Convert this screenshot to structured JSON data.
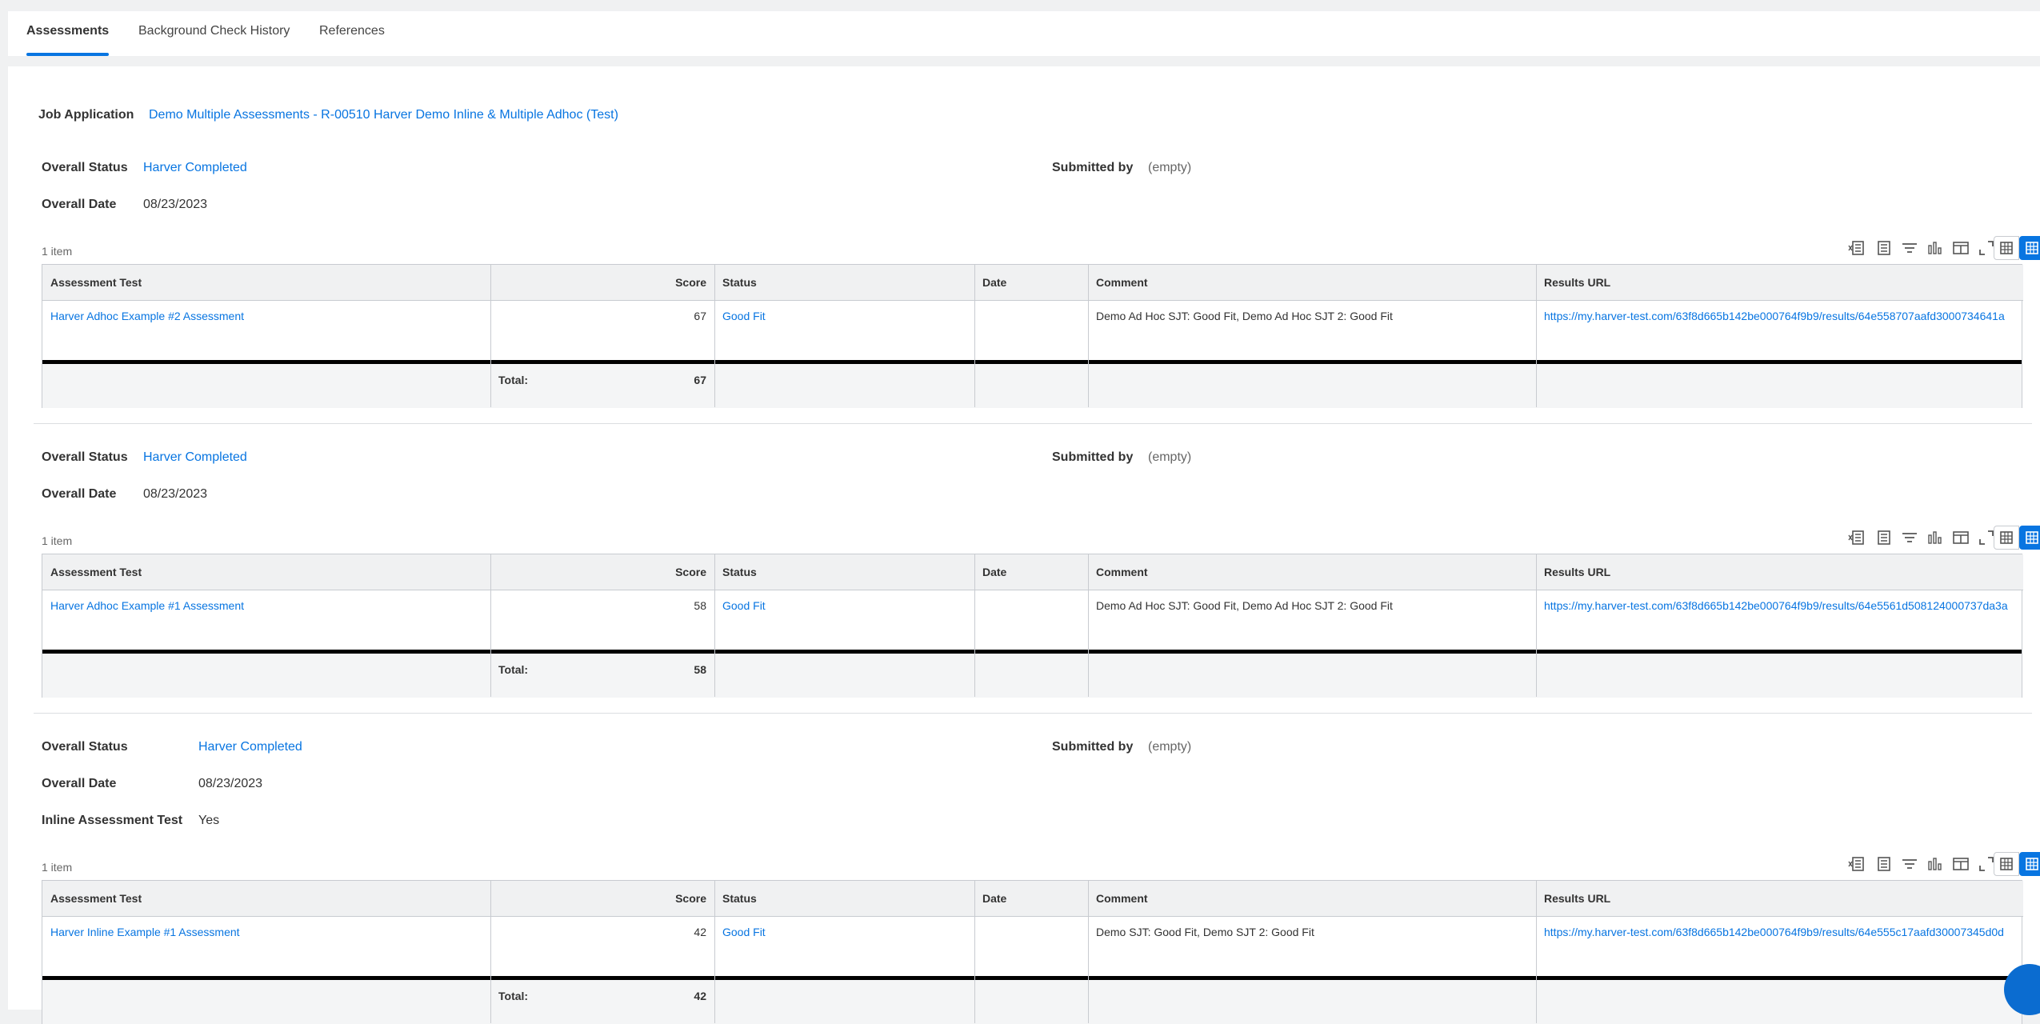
{
  "tabs": [
    "Assessments",
    "Background Check History",
    "References"
  ],
  "job_application": {
    "label": "Job Application",
    "value": "Demo Multiple Assessments - R-00510 Harver Demo Inline & Multiple Adhoc (Test)"
  },
  "field_labels": {
    "overall_status": "Overall Status",
    "overall_date": "Overall Date",
    "submitted_by": "Submitted by",
    "inline_test": "Inline Assessment Test"
  },
  "columns": [
    "Assessment Test",
    "Score",
    "Status",
    "Date",
    "Comment",
    "Results URL"
  ],
  "total_label": "Total:",
  "sections": [
    {
      "overall_status": "Harver Completed",
      "overall_date": "08/23/2023",
      "submitted_by": "(empty)",
      "item_count": "1 item",
      "row": {
        "test": "Harver Adhoc Example #2 Assessment",
        "score": "67",
        "status": "Good Fit",
        "date": "",
        "comment": "Demo Ad Hoc SJT: Good Fit, Demo Ad Hoc SJT 2: Good Fit",
        "url": "https://my.harver-test.com/63f8d665b142be000764f9b9/results/64e558707aafd3000734641a"
      },
      "total": "67"
    },
    {
      "overall_status": "Harver Completed",
      "overall_date": "08/23/2023",
      "submitted_by": "(empty)",
      "item_count": "1 item",
      "row": {
        "test": "Harver Adhoc Example #1 Assessment",
        "score": "58",
        "status": "Good Fit",
        "date": "",
        "comment": "Demo Ad Hoc SJT: Good Fit, Demo Ad Hoc SJT 2: Good Fit",
        "url": "https://my.harver-test.com/63f8d665b142be000764f9b9/results/64e5561d508124000737da3a"
      },
      "total": "58"
    },
    {
      "overall_status": "Harver Completed",
      "overall_date": "08/23/2023",
      "submitted_by": "(empty)",
      "inline_test": "Yes",
      "item_count": "1 item",
      "row": {
        "test": "Harver Inline Example #1 Assessment",
        "score": "42",
        "status": "Good Fit",
        "date": "",
        "comment": "Demo SJT: Good Fit, Demo SJT 2: Good Fit",
        "url": "https://my.harver-test.com/63f8d665b142be000764f9b9/results/64e555c17aafd30007345d0d"
      },
      "total": "42"
    }
  ],
  "icons": [
    "export-excel-icon",
    "pdf-icon",
    "filter-icon",
    "chart-icon",
    "columns-icon",
    "fullscreen-icon",
    "table-view-icon",
    "grid-view-icon"
  ],
  "colors": {
    "link": "#0875e1",
    "accent": "#0875e1",
    "header_bg": "#f0f1f2"
  }
}
